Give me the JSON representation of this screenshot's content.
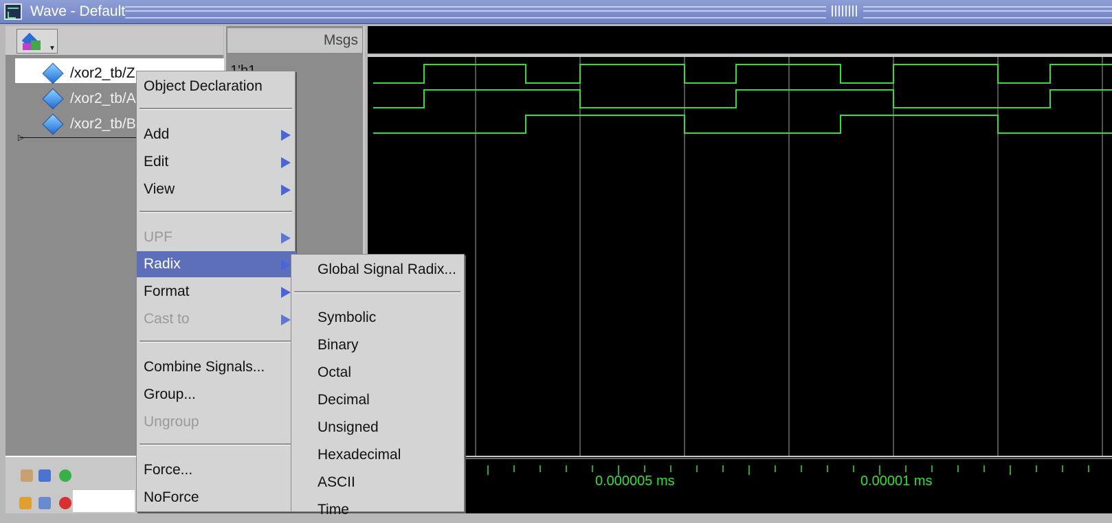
{
  "window": {
    "title": "Wave - Default"
  },
  "names_pane": {
    "signals": [
      {
        "name": "/xor2_tb/Z"
      },
      {
        "name": "/xor2_tb/A"
      },
      {
        "name": "/xor2_tb/B"
      }
    ]
  },
  "msgs_pane": {
    "header": "Msgs",
    "selected_value": "1'h1"
  },
  "context_menu": {
    "items": [
      {
        "label": "Object Declaration",
        "disabled": false,
        "submenu": false
      },
      {
        "label": "Add",
        "disabled": false,
        "submenu": true
      },
      {
        "label": "Edit",
        "disabled": false,
        "submenu": true
      },
      {
        "label": "View",
        "disabled": false,
        "submenu": true
      },
      {
        "label": "UPF",
        "disabled": true,
        "submenu": true
      },
      {
        "label": "Radix",
        "disabled": false,
        "submenu": true,
        "active": true
      },
      {
        "label": "Format",
        "disabled": false,
        "submenu": true
      },
      {
        "label": "Cast to",
        "disabled": true,
        "submenu": true
      },
      {
        "label": "Combine Signals...",
        "disabled": false,
        "submenu": false
      },
      {
        "label": "Group...",
        "disabled": false,
        "submenu": false
      },
      {
        "label": "Ungroup",
        "disabled": true,
        "submenu": false
      },
      {
        "label": "Force...",
        "disabled": false,
        "submenu": false
      },
      {
        "label": "NoForce",
        "disabled": false,
        "submenu": false
      }
    ]
  },
  "radix_submenu": {
    "items": [
      "Global Signal Radix...",
      "Symbolic",
      "Binary",
      "Octal",
      "Decimal",
      "Unsigned",
      "Hexadecimal",
      "ASCII",
      "Time"
    ]
  },
  "time_axis": {
    "labels": [
      "0.000005 ms",
      "0.00001 ms"
    ]
  },
  "colors": {
    "wave": "#35e035",
    "grid": "#8a8a8a",
    "menu_highlight": "#5d6fb8",
    "title_bar": "#7c8dcf"
  }
}
